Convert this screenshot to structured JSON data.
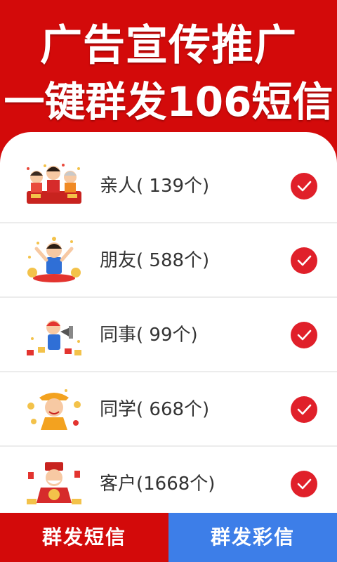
{
  "banner": {
    "line1": "广告宣传推广",
    "line2": "一键群发106短信"
  },
  "contacts": [
    {
      "label": "亲人( 139个)",
      "icon": "family-illustration-icon",
      "checked": true
    },
    {
      "label": "朋友( 588个)",
      "icon": "friend-illustration-icon",
      "checked": true
    },
    {
      "label": "同事(  99个)",
      "icon": "colleague-illustration-icon",
      "checked": true
    },
    {
      "label": "同学( 668个)",
      "icon": "classmate-illustration-icon",
      "checked": true
    },
    {
      "label": "客户(1668个)",
      "icon": "customer-illustration-icon",
      "checked": true
    }
  ],
  "buttons": {
    "sms": "群发短信",
    "mms": "群发彩信"
  },
  "colors": {
    "brand_red": "#d30a0a",
    "check_red": "#e0202a",
    "mms_blue": "#3d7ee8"
  }
}
